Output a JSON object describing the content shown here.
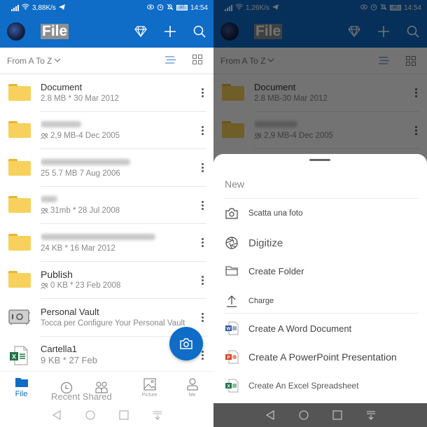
{
  "left": {
    "status": {
      "speed": "3,88K/s",
      "battery": "97",
      "time": "14:54"
    },
    "appbar": {
      "title": "File",
      "icons": [
        "diamond-icon",
        "plus-icon",
        "search-icon"
      ]
    },
    "sortbar": {
      "sort_label": "From A To Z",
      "icons": [
        "list-view-icon",
        "grid-view-icon"
      ]
    },
    "files": [
      {
        "name": "Document",
        "meta": "2.8 MB * 30 Mar 2012",
        "type": "folder",
        "shared": false,
        "name_blurred": false
      },
      {
        "name": "",
        "meta": "2,9 MB-4 Dec 2005",
        "type": "folder",
        "shared": true,
        "name_blurred": true
      },
      {
        "name": "",
        "meta": "25 5.7 MB 7 Aug 2006",
        "type": "folder",
        "shared": false,
        "name_blurred": true
      },
      {
        "name": "",
        "meta": "31mb * 28 Jul 2008",
        "type": "folder",
        "shared": true,
        "name_blurred": true
      },
      {
        "name": "",
        "meta": "24 KB * 16 Mar 2012",
        "type": "folder",
        "shared": false,
        "name_blurred": true
      },
      {
        "name": "Publish",
        "meta": "0 KB * 23 Feb 2008",
        "type": "folder",
        "shared": true,
        "name_blurred": false
      },
      {
        "name": "Personal Vault",
        "meta": "Tocca per Configure Your Personal Vault",
        "type": "vault",
        "shared": false,
        "name_blurred": false
      },
      {
        "name": "Cartella1",
        "meta": "9 KB * 27 Feb",
        "type": "excel",
        "shared": false,
        "name_blurred": false
      }
    ],
    "fab": {
      "icon": "camera-icon"
    },
    "bottomnav": [
      {
        "label": "File",
        "icon": "folder-icon",
        "active": true
      },
      {
        "label": "Recent Shared",
        "icon": "clock-icon",
        "active": false
      },
      {
        "label": "Picture",
        "icon": "picture-icon",
        "active": false
      },
      {
        "label": "Me",
        "icon": "person-icon",
        "active": false
      }
    ]
  },
  "right": {
    "status": {
      "speed": "1,26K/s",
      "battery": "97",
      "time": "14:54"
    },
    "appbar": {
      "title": "File"
    },
    "sortbar": {
      "sort_label": "From A To Z"
    },
    "files": [
      {
        "name": "Document",
        "meta": "2.8 MB-30 Mar 2012"
      },
      {
        "name": "",
        "meta": "2,9 MB-4 Dec 2005"
      }
    ],
    "sheet": {
      "title": "New",
      "items": [
        {
          "label": "Scatta una foto",
          "icon": "camera-icon"
        },
        {
          "label": "Digitize",
          "icon": "aperture-icon"
        },
        {
          "label": "Create Folder",
          "icon": "folder-outline-icon"
        },
        {
          "label": "Charge",
          "icon": "upload-icon"
        },
        {
          "label": "Create A Word Document",
          "icon": "word-icon"
        },
        {
          "label": "Create A PowerPoint Presentation",
          "icon": "powerpoint-icon"
        },
        {
          "label": "Create An Excel Spreadsheet",
          "icon": "excel-icon"
        }
      ]
    }
  },
  "colors": {
    "brand": "#0f6cc7",
    "folder": "#f8d15c",
    "word": "#2b579a",
    "powerpoint": "#d24726",
    "excel": "#217346"
  }
}
